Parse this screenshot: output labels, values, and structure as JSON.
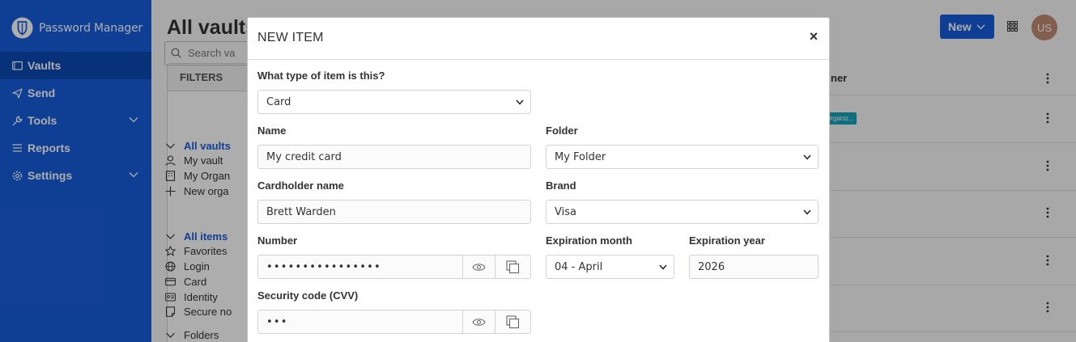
{
  "app": {
    "name": "Password Manager"
  },
  "sidebar": {
    "items": [
      {
        "label": "Vaults",
        "icon": "vault-icon"
      },
      {
        "label": "Send",
        "icon": "send-icon"
      },
      {
        "label": "Tools",
        "icon": "wrench-icon"
      },
      {
        "label": "Reports",
        "icon": "reports-icon"
      },
      {
        "label": "Settings",
        "icon": "gear-icon"
      }
    ]
  },
  "main": {
    "title": "All vaults",
    "new_label": "New",
    "avatar_initials": "US",
    "filters": {
      "heading": "FILTERS",
      "search_placeholder": "Search va",
      "vaults": [
        "All vaults",
        "My vault",
        "My Organ",
        "New orga"
      ],
      "items": [
        "All items",
        "Favorites",
        "Login",
        "Card",
        "Identity",
        "Secure no"
      ],
      "folders_label": "Folders"
    },
    "owner_column": "ner",
    "org_badge": "Organiz..."
  },
  "modal": {
    "title": "NEW ITEM",
    "close": "×",
    "type_label": "What type of item is this?",
    "type_value": "Card",
    "name_label": "Name",
    "name_value": "My credit card",
    "folder_label": "Folder",
    "folder_value": "My Folder",
    "cardholder_label": "Cardholder name",
    "cardholder_value": "Brett Warden",
    "brand_label": "Brand",
    "brand_value": "Visa",
    "number_label": "Number",
    "number_value": "••••••••••••••••",
    "exp_month_label": "Expiration month",
    "exp_month_value": "04 - April",
    "exp_year_label": "Expiration year",
    "exp_year_value": "2026",
    "cvv_label": "Security code (CVV)",
    "cvv_value": "•••"
  },
  "colors": {
    "brand": "#175ddc",
    "badge": "#17a2b8"
  }
}
